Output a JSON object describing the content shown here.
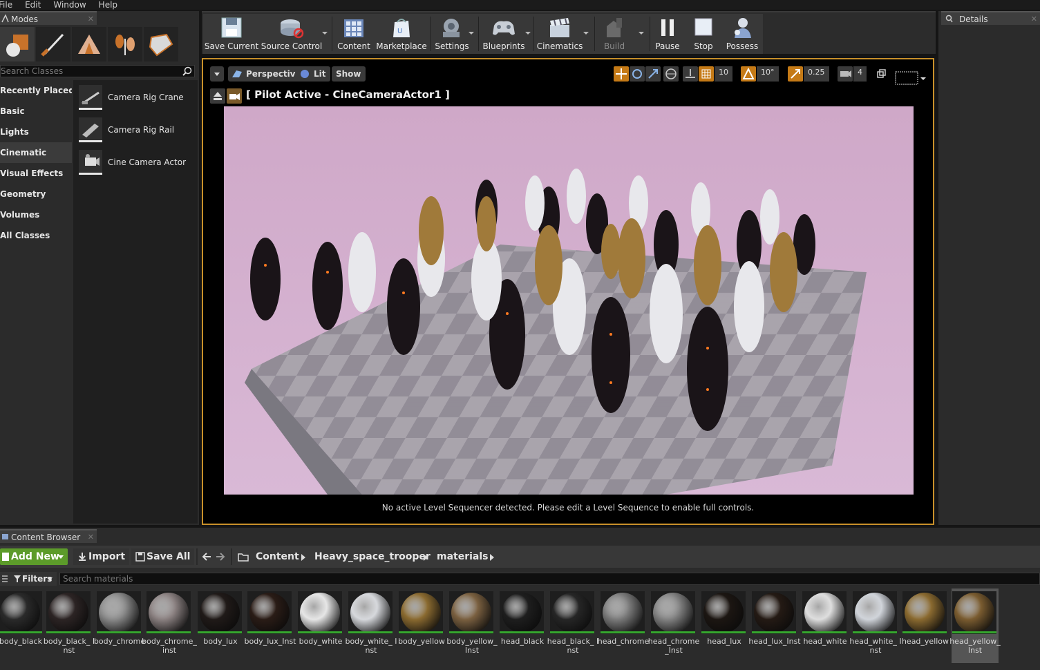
{
  "menu": [
    "File",
    "Edit",
    "Window",
    "Help"
  ],
  "modes_panel": {
    "tab_title": "Modes",
    "search_placeholder": "Search Classes",
    "categories": [
      "Recently Placed",
      "Basic",
      "Lights",
      "Cinematic",
      "Visual Effects",
      "Geometry",
      "Volumes",
      "All Classes"
    ],
    "selected_category": "Cinematic",
    "classes": [
      "Camera Rig Crane",
      "Camera Rig Rail",
      "Cine Camera Actor"
    ]
  },
  "toolbar": {
    "save_current": "Save Current",
    "source_control": "Source Control",
    "content": "Content",
    "marketplace": "Marketplace",
    "settings": "Settings",
    "blueprints": "Blueprints",
    "cinematics": "Cinematics",
    "build": "Build",
    "pause": "Pause",
    "stop": "Stop",
    "possess": "Possess"
  },
  "viewport": {
    "perspective": "Perspective",
    "lit": "Lit",
    "show": "Show",
    "grid_snap": "10",
    "rotation_snap": "10°",
    "scale_snap": "0.25",
    "camera_speed": "4",
    "pilot_label": "[ Pilot Active - CineCameraActor1 ]",
    "message": "No active Level Sequencer detected. Please edit a Level Sequence to enable full controls."
  },
  "details_panel": {
    "tab_title": "Details"
  },
  "content_browser": {
    "tab_title": "Content Browser",
    "add_new": "Add New",
    "import": "Import",
    "save_all": "Save All",
    "breadcrumb": [
      "Content",
      "Heavy_space_trooper",
      "materials"
    ],
    "filters": "Filters",
    "search_placeholder": "Search materials",
    "assets": [
      {
        "name": "body_black",
        "tone": "#2a2a2a"
      },
      {
        "name": "body_black_ Inst",
        "tone": "#2c2424"
      },
      {
        "name": "body_chrome",
        "tone": "#8a8a8a"
      },
      {
        "name": "body_chrome_ inst",
        "tone": "#8a8080"
      },
      {
        "name": "body_lux",
        "tone": "#201a18"
      },
      {
        "name": "body_lux_Inst",
        "tone": "#2a1c16"
      },
      {
        "name": "body_white",
        "tone": "#e6e6e6"
      },
      {
        "name": "body_white_ Inst",
        "tone": "#d6d8dc"
      },
      {
        "name": "body_yellow",
        "tone": "#8a6a30"
      },
      {
        "name": "body_yellow_ Inst",
        "tone": "#7a6040"
      },
      {
        "name": "head_black",
        "tone": "#1e1e1e"
      },
      {
        "name": "head_black_ Inst",
        "tone": "#262626"
      },
      {
        "name": "head_chrome",
        "tone": "#7a7a7a"
      },
      {
        "name": "head_chrome _Inst",
        "tone": "#828282"
      },
      {
        "name": "head_lux",
        "tone": "#1c1612"
      },
      {
        "name": "head_lux_Inst",
        "tone": "#241a14"
      },
      {
        "name": "head_white",
        "tone": "#dedede"
      },
      {
        "name": "head_white_ Inst",
        "tone": "#d0d4da"
      },
      {
        "name": "head_yellow",
        "tone": "#8a6a30"
      },
      {
        "name": "head_yellow_ Inst",
        "tone": "#7a5c30"
      }
    ],
    "selected_asset": "head_yellow_ Inst"
  },
  "colors": {
    "accent_orange": "#c8902a",
    "add_new_green": "#5c9b2a",
    "asset_underline": "#36a82e",
    "viewport_background": "#d4b0cc"
  }
}
